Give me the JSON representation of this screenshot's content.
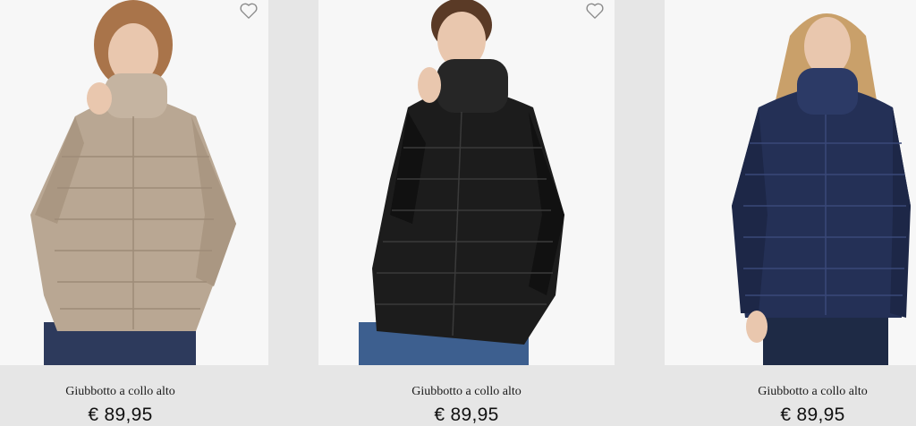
{
  "products": [
    {
      "name": "Giubbotto a collo alto",
      "price": "€ 89,95",
      "jacket_color": "#b9a793",
      "has_wishlist": true
    },
    {
      "name": "Giubbotto a collo alto",
      "price": "€ 89,95",
      "jacket_color": "#1c1c1c",
      "has_wishlist": true
    },
    {
      "name": "Giubbotto a collo alto",
      "price": "€ 89,95",
      "jacket_color": "#243056",
      "has_wishlist": false
    }
  ],
  "colors": {
    "background": "#e6e6e6",
    "photo_background": "#f7f7f7",
    "skin": "#e9c7ae",
    "jeans": "#2d3a5c"
  },
  "icons": {
    "wishlist": "heart-outline-icon"
  }
}
